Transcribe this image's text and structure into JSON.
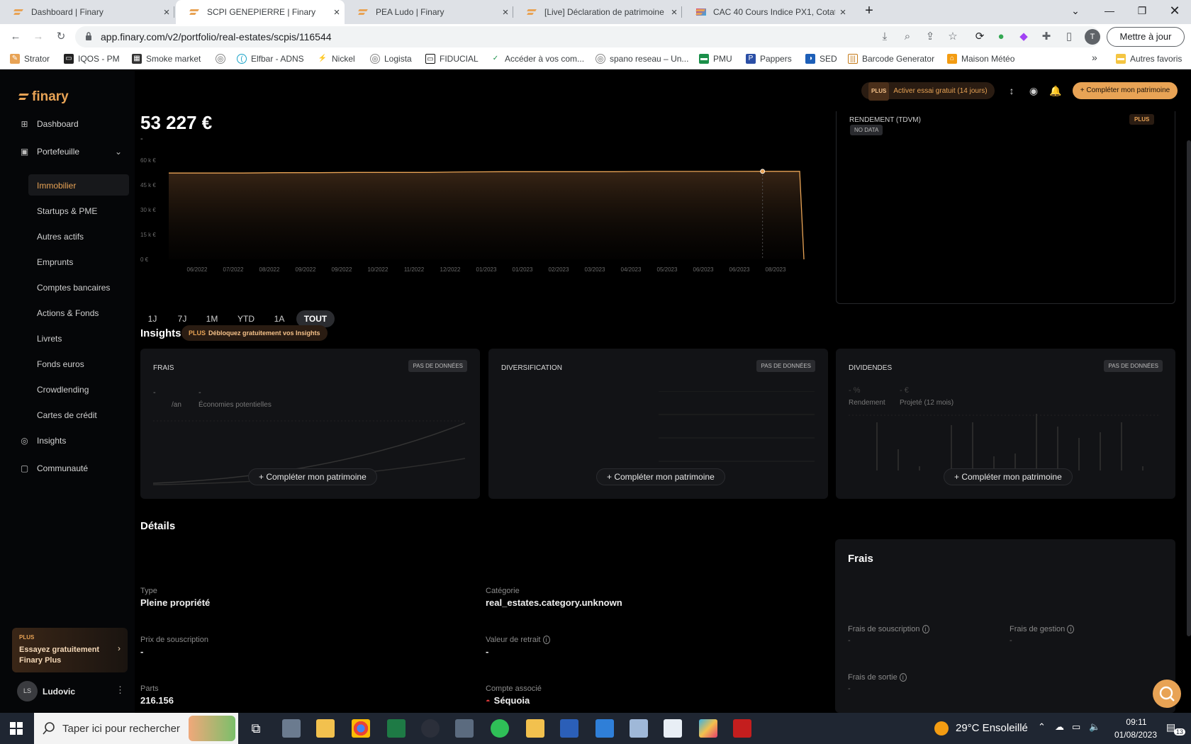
{
  "browser": {
    "tabs": [
      {
        "title": "Dashboard | Finary",
        "active": false
      },
      {
        "title": "SCPI GENEPIERRE | Finary",
        "active": true
      },
      {
        "title": "PEA Ludo | Finary",
        "active": false
      },
      {
        "title": "[Live] Déclaration de patrimoine (",
        "active": false
      },
      {
        "title": "CAC 40 Cours Indice PX1, Cotatio",
        "active": false
      }
    ],
    "url": "app.finary.com/v2/portfolio/real-estates/scpis/116544",
    "update_label": "Mettre à jour",
    "profile_initial": "T",
    "bookmarks": [
      "Strator",
      "IQOS - PM",
      "Smoke market",
      "Elfbar - ADNS",
      "Nickel",
      "Logista",
      "FIDUCIAL",
      "Accéder à vos com...",
      "spano reseau – Un...",
      "PMU",
      "Pappers",
      "SED",
      "Barcode Generator",
      "Maison Météo"
    ],
    "bookmarks_more": "»",
    "other_bookmarks": "Autres favoris"
  },
  "sidebar": {
    "logo": "finary",
    "dashboard": "Dashboard",
    "portfolio": "Portefeuille",
    "sub_items": [
      "Immobilier",
      "Startups & PME",
      "Autres actifs",
      "Emprunts",
      "Comptes bancaires",
      "Actions & Fonds",
      "Livrets",
      "Fonds euros",
      "Crowdlending",
      "Cartes de crédit"
    ],
    "insights": "Insights",
    "community": "Communauté",
    "plus_card": {
      "badge": "PLUS",
      "line1": "Essayez gratuitement",
      "line2": "Finary Plus"
    },
    "user": {
      "initials": "LS",
      "name": "Ludovic"
    }
  },
  "topbar": {
    "trial_badge": "PLUS",
    "trial_label": "Activer essai gratuit (14 jours)",
    "complete_label": "Compléter mon patrimoine"
  },
  "asset": {
    "amount": "53 227 €",
    "amount_sub": "-"
  },
  "chart_data": {
    "type": "area",
    "y_ticks": [
      "60 k €",
      "45 k €",
      "30 k €",
      "15 k €",
      "0 €"
    ],
    "ylim": [
      0,
      60000
    ],
    "x_labels": [
      "06/2022",
      "07/2022",
      "08/2022",
      "09/2022",
      "09/2022",
      "10/2022",
      "11/2022",
      "12/2022",
      "01/2023",
      "01/2023",
      "02/2023",
      "03/2023",
      "04/2023",
      "05/2023",
      "06/2023",
      "06/2023",
      "08/2023"
    ],
    "values": [
      52200,
      52200,
      52200,
      52400,
      52400,
      52600,
      52600,
      52600,
      52900,
      53000,
      53000,
      53000,
      53000,
      53200,
      53200,
      53200,
      53227,
      53227,
      0
    ],
    "marker_index": 16
  },
  "ranges": [
    "1J",
    "7J",
    "1M",
    "YTD",
    "1A",
    "TOUT"
  ],
  "range_selected": "TOUT",
  "rendement": {
    "title": "RENDEMENT (TDVM)",
    "nodata": "NO DATA",
    "plus": "PLUS"
  },
  "insights": {
    "title": "Insights",
    "badge_plus": "PLUS",
    "badge_text": "Débloquez gratuitement vos Insights",
    "cards": [
      {
        "title": "FRAIS",
        "badge": "PAS DE DONNÉES",
        "button": "Compléter mon patrimoine",
        "dash": "-",
        "per_year": "/an",
        "savings_value": "-",
        "savings_label": "Économies potentielles"
      },
      {
        "title": "DIVERSIFICATION",
        "badge": "PAS DE DONNÉES",
        "button": "Compléter mon patrimoine"
      },
      {
        "title": "DIVIDENDES",
        "badge": "PAS DE DONNÉES",
        "button": "Compléter mon patrimoine",
        "yield_value": "- %",
        "yield_label": "Rendement",
        "projected_value": "- €",
        "projected_label": "Projeté (12 mois)"
      }
    ]
  },
  "details": {
    "title": "Détails",
    "type_label": "Type",
    "type_value": "Pleine propriété",
    "category_label": "Catégorie",
    "category_value": "real_estates.category.unknown",
    "price_label": "Prix de souscription",
    "price_value": "-",
    "withdrawal_label": "Valeur de retrait",
    "withdrawal_value": "-",
    "shares_label": "Parts",
    "shares_value": "216.156",
    "account_label": "Compte associé",
    "account_value": "Séquoia"
  },
  "frais": {
    "title": "Frais",
    "subscription_label": "Frais de souscription",
    "subscription_value": "-",
    "management_label": "Frais de gestion",
    "management_value": "-",
    "exit_label": "Frais de sortie",
    "exit_value": "-"
  },
  "taskbar": {
    "search_placeholder": "Taper ici pour rechercher",
    "weather": "29°C  Ensoleillé",
    "time": "09:11",
    "date": "01/08/2023",
    "notifications": "13"
  }
}
